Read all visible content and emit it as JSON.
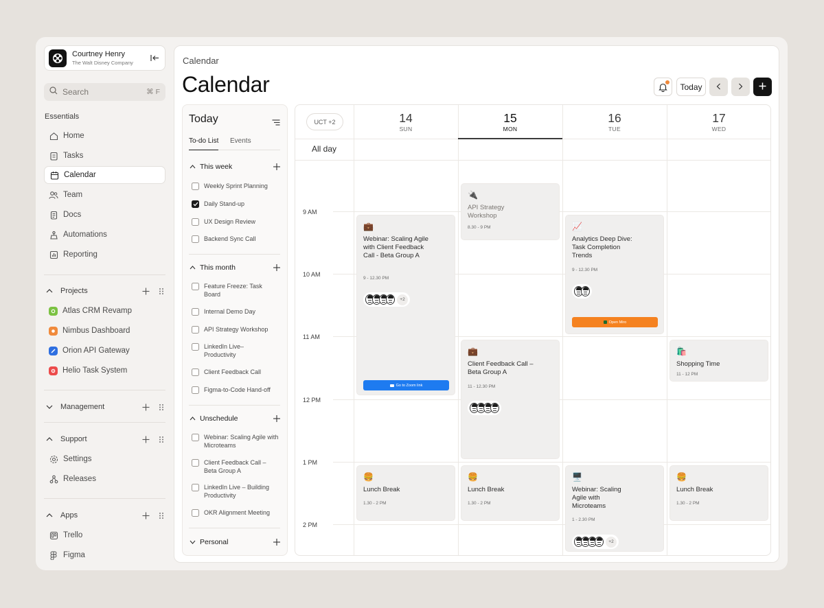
{
  "account": {
    "name": "Courtney Henry",
    "org": "The Walt Disney Company"
  },
  "search": {
    "label": "Search",
    "shortcut": "⌘ F"
  },
  "sidebar": {
    "essentials_label": "Essentials",
    "nav": [
      {
        "label": "Home",
        "icon": "home-icon"
      },
      {
        "label": "Tasks",
        "icon": "tasks-icon"
      },
      {
        "label": "Calendar",
        "icon": "calendar-icon",
        "active": true
      },
      {
        "label": "Team",
        "icon": "team-icon"
      },
      {
        "label": "Docs",
        "icon": "docs-icon"
      },
      {
        "label": "Automations",
        "icon": "automations-icon"
      },
      {
        "label": "Reporting",
        "icon": "reporting-icon"
      }
    ],
    "projects_label": "Projects",
    "projects": [
      {
        "label": "Atlas CRM Revamp",
        "color": "#7cc243"
      },
      {
        "label": "Nimbus Dashboard",
        "color": "#f08a3c"
      },
      {
        "label": "Orion API Gateway",
        "color": "#2f6fe0"
      },
      {
        "label": "Helio Task System",
        "color": "#ec4b4b"
      }
    ],
    "management_label": "Management",
    "support_label": "Support",
    "support_items": [
      {
        "label": "Settings",
        "icon": "settings-icon"
      },
      {
        "label": "Releases",
        "icon": "releases-icon"
      }
    ],
    "apps_label": "Apps",
    "apps": [
      {
        "label": "Trello",
        "icon": "trello-icon"
      },
      {
        "label": "Figma",
        "icon": "figma-icon"
      }
    ]
  },
  "header": {
    "breadcrumb": "Calendar",
    "title": "Calendar",
    "today_button": "Today",
    "notification_dot_color": "#f08a3c"
  },
  "todo": {
    "title": "Today",
    "tabs": [
      "To-do List",
      "Events"
    ],
    "sections": [
      {
        "title": "This week",
        "items": [
          {
            "label": "Weekly Sprint Planning",
            "checked": false
          },
          {
            "label": "Daily Stand-up",
            "checked": true
          },
          {
            "label": "UX Design Review",
            "checked": false
          },
          {
            "label": "Backend Sync Call",
            "checked": false
          }
        ]
      },
      {
        "title": "This month",
        "items": [
          {
            "label": "Feature Freeze: Task Board",
            "checked": false
          },
          {
            "label": "Internal Demo Day",
            "checked": false
          },
          {
            "label": "API Strategy Workshop",
            "checked": false
          },
          {
            "label": "LinkedIn Live– Productivity",
            "checked": false
          },
          {
            "label": "Client Feedback Call",
            "checked": false
          },
          {
            "label": "Figma-to-Code Hand-off",
            "checked": false
          }
        ]
      },
      {
        "title": "Unschedule",
        "items": [
          {
            "label": "Webinar: Scaling Agile with Microteams",
            "checked": false
          },
          {
            "label": "Client Feedback Call – Beta Group A",
            "checked": false
          },
          {
            "label": "LinkedIn Live – Building Productivity",
            "checked": false
          },
          {
            "label": "OKR Alignment Meeting",
            "checked": false
          }
        ]
      },
      {
        "title": "Personal",
        "items": []
      }
    ]
  },
  "calendar": {
    "timezone": "UCT +2",
    "allday_label": "All day",
    "days": [
      {
        "num": "14",
        "name": "SUN"
      },
      {
        "num": "15",
        "name": "MON",
        "today": true
      },
      {
        "num": "16",
        "name": "TUE"
      },
      {
        "num": "17",
        "name": "WED"
      }
    ],
    "times": [
      "9 AM",
      "10 AM",
      "11 AM",
      "12 PM",
      "1 PM",
      "2 PM"
    ],
    "events": {
      "webinar_client": {
        "emoji": "💼",
        "title": "Webinar: Scaling Agile with Client Feedback Call - Beta Group A",
        "time": "9 - 12.30 PM",
        "more": "+2",
        "button": "Go to Zoom link",
        "button_color": "#1e7bf0"
      },
      "api_workshop": {
        "emoji": "🔌",
        "title": "API Strategy Workshop",
        "time": "8.30 - 9 PM"
      },
      "analytics": {
        "emoji": "📈",
        "title": "Analytics Deep Dive: Task Completion Trends",
        "time": "9 - 12.30 PM",
        "button": "Open Miro",
        "button_color": "#f58220"
      },
      "client_feedback": {
        "emoji": "💼",
        "title": "Client Feedback Call – Beta Group A",
        "time": "11 - 12.30 PM"
      },
      "shopping": {
        "emoji": "🛍️",
        "title": "Shopping Time",
        "time": "11 - 12 PM"
      },
      "lunch_sun": {
        "emoji": "🍔",
        "title": "Lunch Break",
        "time": "1.30 - 2 PM"
      },
      "lunch_mon": {
        "emoji": "🍔",
        "title": "Lunch Break",
        "time": "1.30 - 2 PM"
      },
      "webinar_micro": {
        "emoji": "🖥️",
        "title": "Webinar: Scaling Agile with Microteams",
        "time": "1 - 2.30 PM",
        "more": "+2"
      },
      "lunch_wed": {
        "emoji": "🍔",
        "title": "Lunch Break",
        "time": "1.30 - 2 PM"
      }
    }
  }
}
